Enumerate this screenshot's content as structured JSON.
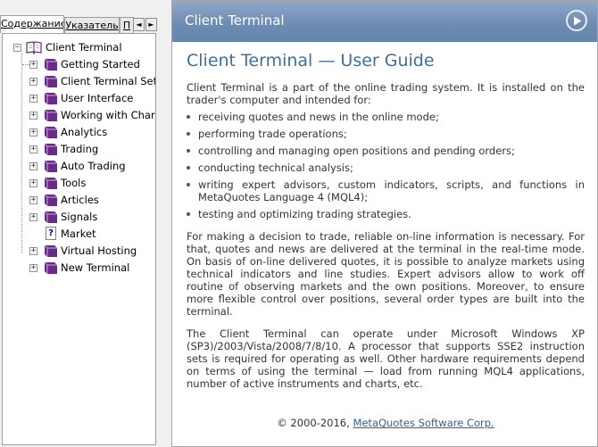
{
  "tabs": {
    "contents": "Содержание",
    "index": "Указатель",
    "search": "П",
    "scroll_left": "◄",
    "scroll_right": "►"
  },
  "tree": {
    "root": "Client Terminal",
    "items": [
      {
        "label": "Getting Started",
        "icon": "book-icon"
      },
      {
        "label": "Client Terminal Settings",
        "icon": "book-icon"
      },
      {
        "label": "User Interface",
        "icon": "book-icon"
      },
      {
        "label": "Working with Charts",
        "icon": "book-icon"
      },
      {
        "label": "Analytics",
        "icon": "book-icon"
      },
      {
        "label": "Trading",
        "icon": "book-icon"
      },
      {
        "label": "Auto Trading",
        "icon": "book-icon"
      },
      {
        "label": "Tools",
        "icon": "book-icon"
      },
      {
        "label": "Articles",
        "icon": "book-icon"
      },
      {
        "label": "Signals",
        "icon": "book-icon"
      },
      {
        "label": "Market",
        "icon": "help-page-icon"
      },
      {
        "label": "Virtual Hosting",
        "icon": "book-icon"
      },
      {
        "label": "New Terminal",
        "icon": "book-icon"
      }
    ]
  },
  "header": {
    "title": "Client Terminal"
  },
  "content": {
    "title": "Client Terminal — User Guide",
    "intro": "Client Terminal is a part of the online trading system. It is installed on the trader's computer and intended for:",
    "bullets": [
      "receiving quotes and news in the online mode;",
      "performing trade operations;",
      "controlling and managing open positions and pending orders;",
      "conducting technical analysis;",
      "writing expert advisors, custom indicators, scripts, and functions in MetaQuotes Language 4 (MQL4);",
      "testing and optimizing trading strategies."
    ],
    "para2": "For making a decision to trade, reliable on-line information is necessary. For that, quotes and news are delivered at the terminal in the real-time mode. On basis of on-line delivered quotes, it is possible to analyze markets using technical indicators and line studies. Expert advisors allow to work off routine of observing markets and the own positions. Moreover, to ensure more flexible control over positions, several order types are built into the terminal.",
    "para3": "The Client Terminal can operate under Microsoft Windows XP (SP3)/2003/Vista/2008/7/8/10. A processor that supports SSE2 instruction sets is required for operating as well. Other hardware requirements depend on terms of using the terminal — load from running MQL4 applications, number of active instruments and charts, etc."
  },
  "footer": {
    "copyright": "© 2000-2016, ",
    "link": "MetaQuotes Software Corp."
  },
  "colors": {
    "header_gradient_top": "#8ea9c9",
    "header_gradient_bottom": "#6485ad",
    "title_blue": "#3e6fa0",
    "book_purple": "#6a2a8a"
  }
}
